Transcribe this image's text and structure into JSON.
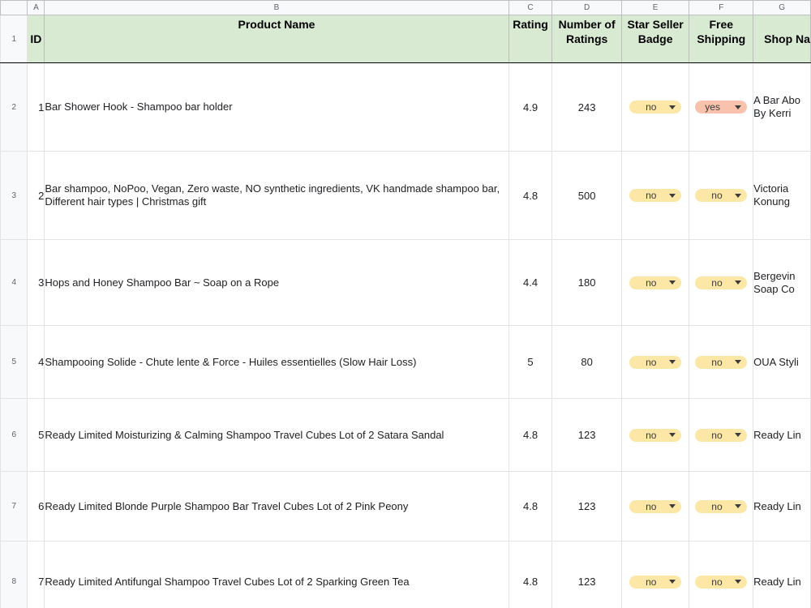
{
  "column_letters": [
    "A",
    "B",
    "C",
    "D",
    "E",
    "F",
    "G"
  ],
  "headers": {
    "id": "ID",
    "product_name": "Product Name",
    "rating": "Rating",
    "num_ratings": "Number of Ratings",
    "star_seller": "Star Seller Badge",
    "free_shipping": "Free Shipping",
    "shop_name": "Shop Na"
  },
  "rows": [
    {
      "row": "2",
      "id": "1",
      "name": "Bar Shower Hook - Shampoo bar holder",
      "rating": "4.9",
      "count": "243",
      "star": "no",
      "shipping": "yes",
      "shop": "A Bar Abo\nBy Kerri"
    },
    {
      "row": "3",
      "id": "2",
      "name": "Bar shampoo, NoPoo, Vegan, Zero waste, NO synthetic ingredients, VK handmade shampoo bar, Different hair types | Christmas gift",
      "rating": "4.8",
      "count": "500",
      "star": "no",
      "shipping": "no",
      "shop": "Victoria\nKonung"
    },
    {
      "row": "4",
      "id": "3",
      "name": "Hops and Honey Shampoo Bar ~ Soap on a Rope",
      "rating": "4.4",
      "count": "180",
      "star": "no",
      "shipping": "no",
      "shop": "Bergevin\nSoap Co"
    },
    {
      "row": "5",
      "id": "4",
      "name": "Shampooing Solide - Chute lente & Force - Huiles essentielles (Slow Hair Loss)",
      "rating": "5",
      "count": "80",
      "star": "no",
      "shipping": "no",
      "shop": "OUA Styli"
    },
    {
      "row": "6",
      "id": "5",
      "name": "Ready Limited Moisturizing & Calming Shampoo Travel Cubes Lot of 2 Satara Sandal",
      "rating": "4.8",
      "count": "123",
      "star": "no",
      "shipping": "no",
      "shop": "Ready Lin"
    },
    {
      "row": "7",
      "id": "6",
      "name": "Ready Limited Blonde Purple Shampoo Bar Travel Cubes Lot of 2 Pink Peony",
      "rating": "4.8",
      "count": "123",
      "star": "no",
      "shipping": "no",
      "shop": "Ready Lin"
    },
    {
      "row": "8",
      "id": "7",
      "name": "Ready Limited Antifungal Shampoo Travel Cubes Lot of 2 Sparking Green Tea",
      "rating": "4.8",
      "count": "123",
      "star": "no",
      "shipping": "no",
      "shop": "Ready Lin"
    }
  ],
  "colors": {
    "header_fill": "#d9ead3",
    "chip_no": "#fde7a6",
    "chip_yes": "#f8c2ad",
    "gridline": "#e2e3e3"
  }
}
